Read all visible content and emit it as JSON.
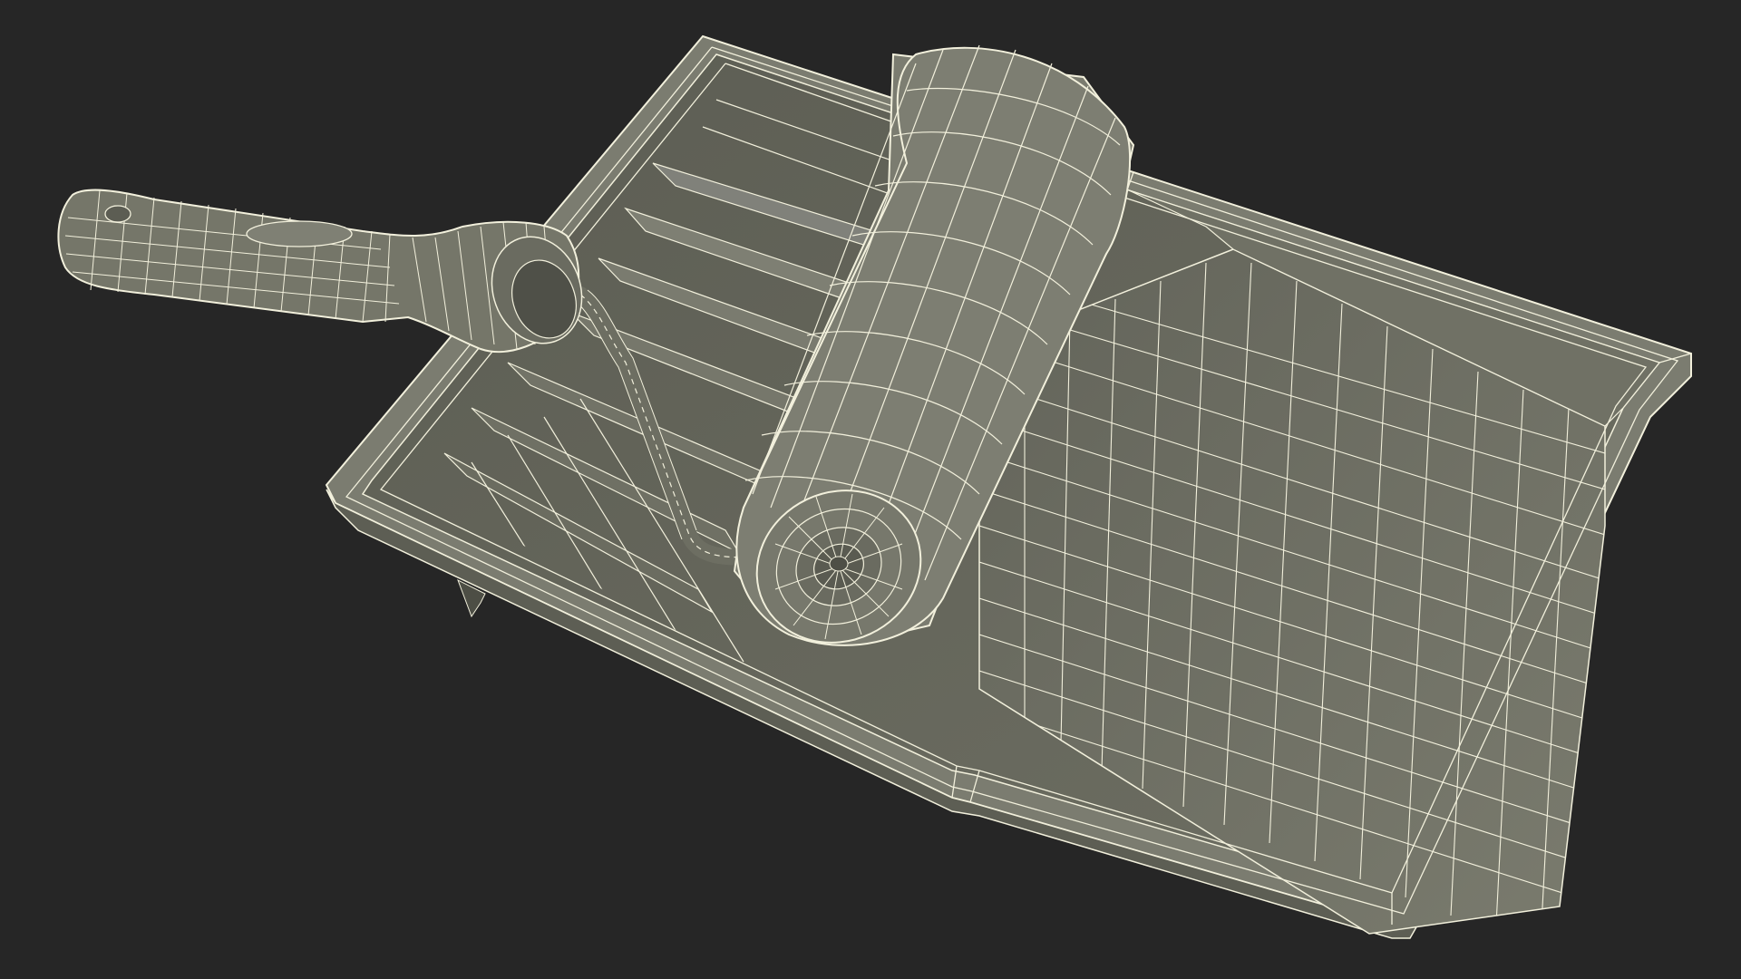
{
  "scene": {
    "subject": "paint-roller-and-tray-wireframe",
    "colors": {
      "background": "#262626",
      "surface": "#6f7064",
      "surface_light": "#8a8b7e",
      "surface_dark": "#54554b",
      "wire": "#f2f0dc"
    }
  }
}
